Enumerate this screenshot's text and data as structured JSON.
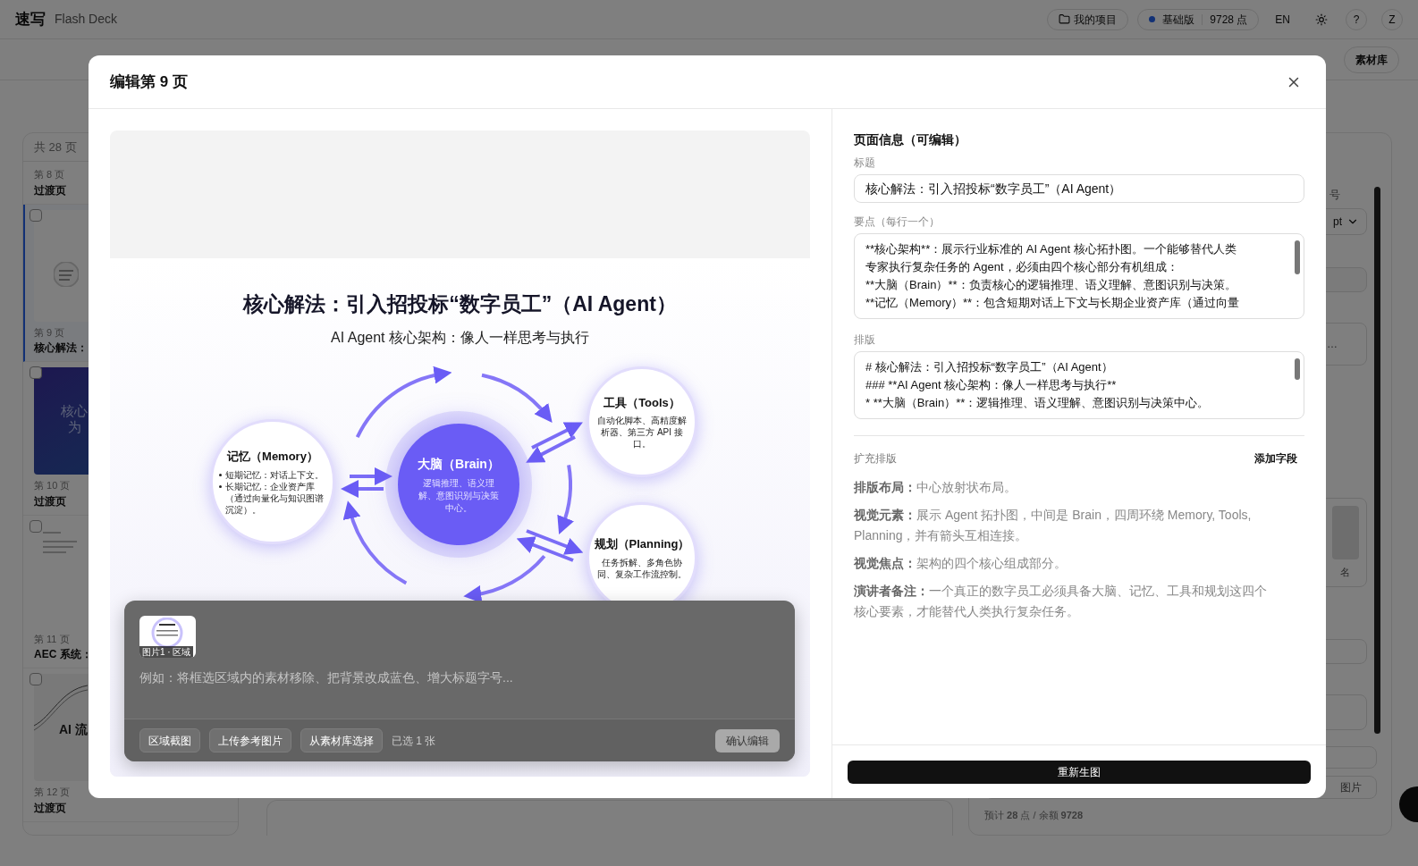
{
  "topbar": {
    "logo": "速写",
    "product": "Flash Deck",
    "projects": "我的项目",
    "plan": "基础版",
    "points": "9728 点",
    "language": "EN",
    "help": "?",
    "avatar": "Z"
  },
  "toolbar": {
    "library": "素材库"
  },
  "sidebar": {
    "count": "共 28 页",
    "pages": [
      {
        "number": "第 8 页",
        "title": "过渡页",
        "selected": false
      },
      {
        "number": "第 9 页",
        "title": "核心解法：",
        "selected": true,
        "checked": false,
        "thumb": {
          "kind": "diagram"
        }
      },
      {
        "number": "第 10 页",
        "title": "过渡页",
        "selected": false,
        "checked": false,
        "thumb": {
          "kind": "cover",
          "lines": [
            "核心",
            "为"
          ]
        }
      },
      {
        "number": "第 11 页",
        "title": "AEC 系统：",
        "selected": false,
        "checked": false,
        "thumb": {
          "kind": "text"
        }
      },
      {
        "number": "第 12 页",
        "title": "过渡页",
        "selected": false,
        "checked": false,
        "thumb": {
          "kind": "wave",
          "lines": [
            "AI 流"
          ]
        }
      }
    ]
  },
  "settings": {
    "label": "号",
    "select": "pt",
    "ellipsis": "…",
    "caption": "名",
    "button": "图片",
    "estimate": "预计 **28** 点 / 余额 **9728**"
  },
  "dialog": {
    "title": "编辑第 9 页",
    "slide": {
      "title": "核心解法：引入招投标“数字员工”（AI Agent）",
      "subtitle": "AI Agent 核心架构：像人一样思考与执行",
      "nodes": [
        {
          "kind": "satellite",
          "title": "记忆（Memory）",
          "bullets": [
            "短期记忆：对话上下文。",
            "长期记忆：企业资产库（通过向量化与知识图谱沉淀）。"
          ]
        },
        {
          "kind": "center",
          "title": "大脑（Brain）",
          "text": "逻辑推理、语义理解、意图识别与决策中心。"
        },
        {
          "kind": "satellite",
          "title": "工具（Tools）",
          "text": "自动化脚本、高精度解析器、第三方 API 接口。"
        },
        {
          "kind": "satellite",
          "title": "规划（Planning）",
          "text": "任务拆解、多角色协同、复杂工作流控制。"
        }
      ]
    },
    "edit_panel": {
      "attachments": [
        {
          "caption": "图片1 · 区域"
        }
      ],
      "placeholder": "例如：将框选区域内的素材移除、把背景改成蓝色、增大标题字号...",
      "actions": [
        "区域截图",
        "上传参考图片",
        "从素材库选择"
      ],
      "selected_count": "已选 1 张",
      "confirm": "确认编辑"
    },
    "info": {
      "heading": "页面信息（可编辑）",
      "title_label": "标题",
      "title_value": "核心解法：引入招投标“数字员工”（AI Agent）",
      "points_label": "要点（每行一个）",
      "points_lines": [
        "**核心架构**：展示行业标准的 AI Agent 核心拓扑图。一个能够替代人类",
        "专家执行复杂任务的 Agent，必须由四个核心部分有机组成：",
        "**大脑（Brain）**：负责核心的逻辑推理、语义理解、意图识别与决策。",
        "**记忆（Memory）**：包含短期对话上下文与长期企业资产库（通过向量"
      ],
      "layout_label": "排版",
      "layout_lines": [
        "# 核心解法：引入招投标“数字员工”（AI Agent）",
        "### **AI Agent 核心架构：像人一样思考与执行**",
        "*   **大脑（Brain）**：逻辑推理、语义理解、意图识别与决策中心。"
      ],
      "extra_heading": "扩充排版",
      "add_field": "添加字段",
      "extra_fields": [
        {
          "label": "排版布局：",
          "value": "中心放射状布局。"
        },
        {
          "label": "视觉元素：",
          "value": "展示 Agent 拓扑图，中间是 Brain，四周环绕 Memory, Tools, Planning，并有箭头互相连接。"
        },
        {
          "label": "视觉焦点：",
          "value": "架构的四个核心组成部分。"
        },
        {
          "label": "演讲者备注：",
          "value": "一个真正的数字员工必须具备大脑、记忆、工具和规划这四个核心要素，才能替代人类执行复杂任务。"
        }
      ]
    },
    "regenerate": "重新生图"
  }
}
